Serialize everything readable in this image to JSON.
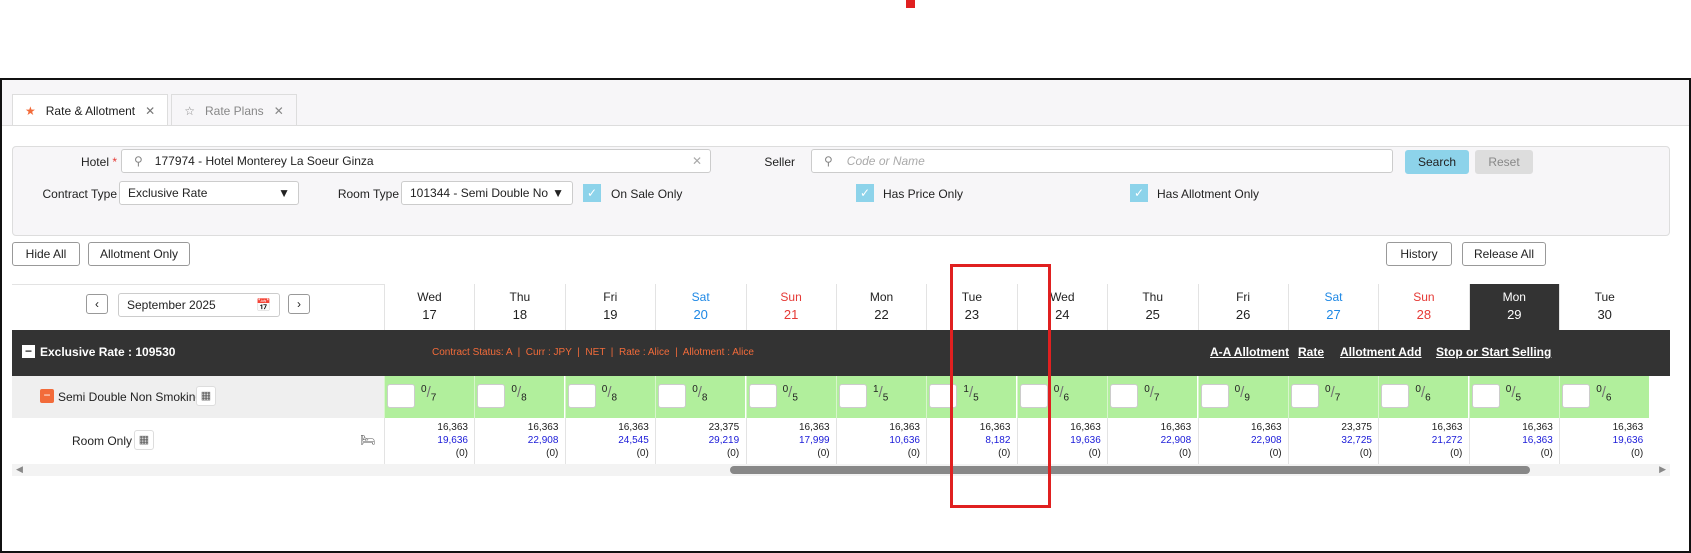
{
  "tabs": [
    {
      "label": "Rate & Allotment",
      "icon": "star-filled-icon"
    },
    {
      "label": "Rate Plans",
      "icon": "star-outline-icon"
    }
  ],
  "filters": {
    "hotel_label": "Hotel",
    "hotel_value": "177974 - Hotel Monterey La Soeur Ginza",
    "seller_label": "Seller",
    "seller_placeholder": "Code or Name",
    "contract_type_label": "Contract Type",
    "contract_type_value": "Exclusive Rate",
    "room_type_label": "Room Type",
    "room_type_value": "101344 - Semi Double No",
    "on_sale_only": "On Sale Only",
    "has_price_only": "Has Price Only",
    "has_allotment_only": "Has Allotment Only",
    "search": "Search",
    "reset": "Reset"
  },
  "toolbar": {
    "hide_all": "Hide All",
    "allotment_only": "Allotment Only",
    "history": "History",
    "release_all": "Release All"
  },
  "month": "September 2025",
  "days": [
    {
      "dow": "Wed",
      "d": "17",
      "type": "",
      "sold": "0",
      "total": "7",
      "p1": "16,363",
      "p2": "19,636",
      "p3": "(0)"
    },
    {
      "dow": "Thu",
      "d": "18",
      "type": "",
      "sold": "0",
      "total": "8",
      "p1": "16,363",
      "p2": "22,908",
      "p3": "(0)"
    },
    {
      "dow": "Fri",
      "d": "19",
      "type": "",
      "sold": "0",
      "total": "8",
      "p1": "16,363",
      "p2": "24,545",
      "p3": "(0)"
    },
    {
      "dow": "Sat",
      "d": "20",
      "type": "sat",
      "sold": "0",
      "total": "8",
      "p1": "23,375",
      "p2": "29,219",
      "p3": "(0)"
    },
    {
      "dow": "Sun",
      "d": "21",
      "type": "sun",
      "sold": "0",
      "total": "5",
      "p1": "16,363",
      "p2": "17,999",
      "p3": "(0)"
    },
    {
      "dow": "Mon",
      "d": "22",
      "type": "",
      "sold": "1",
      "total": "5",
      "p1": "16,363",
      "p2": "10,636",
      "p3": "(0)"
    },
    {
      "dow": "Tue",
      "d": "23",
      "type": "",
      "sold": "1",
      "total": "5",
      "p1": "16,363",
      "p2": "8,182",
      "p3": "(0)"
    },
    {
      "dow": "Wed",
      "d": "24",
      "type": "",
      "sold": "0",
      "total": "6",
      "p1": "16,363",
      "p2": "19,636",
      "p3": "(0)"
    },
    {
      "dow": "Thu",
      "d": "25",
      "type": "",
      "sold": "0",
      "total": "7",
      "p1": "16,363",
      "p2": "22,908",
      "p3": "(0)"
    },
    {
      "dow": "Fri",
      "d": "26",
      "type": "",
      "sold": "0",
      "total": "9",
      "p1": "16,363",
      "p2": "22,908",
      "p3": "(0)"
    },
    {
      "dow": "Sat",
      "d": "27",
      "type": "sat",
      "sold": "0",
      "total": "7",
      "p1": "23,375",
      "p2": "32,725",
      "p3": "(0)"
    },
    {
      "dow": "Sun",
      "d": "28",
      "type": "sun",
      "sold": "0",
      "total": "6",
      "p1": "16,363",
      "p2": "21,272",
      "p3": "(0)"
    },
    {
      "dow": "Mon",
      "d": "29",
      "type": "today",
      "sold": "0",
      "total": "5",
      "p1": "16,363",
      "p2": "16,363",
      "p3": "(0)"
    },
    {
      "dow": "Tue",
      "d": "30",
      "type": "",
      "sold": "0",
      "total": "6",
      "p1": "16,363",
      "p2": "19,636",
      "p3": "(0)"
    }
  ],
  "contract": {
    "title": "Exclusive Rate : 109530",
    "status": "Contract Status: A",
    "curr": "Curr : JPY",
    "net": "NET",
    "rate": "Rate : Alice",
    "allotment": "Allotment : Alice",
    "links": [
      "A-A Allotment",
      "Rate",
      "Allotment Add",
      "Stop or Start Selling"
    ]
  },
  "room": {
    "name": "Semi Double Non Smoking",
    "plan": "Room Only"
  },
  "colors": {
    "accent": "#f26b3a",
    "green": "#b1ef9c",
    "highlight": "#e02020"
  }
}
